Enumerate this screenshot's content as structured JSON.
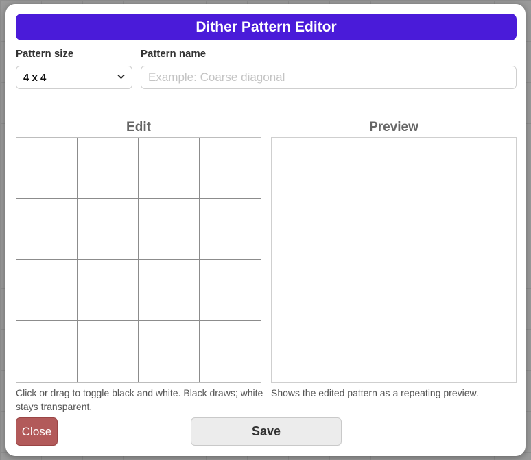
{
  "dialog": {
    "title": "Dither Pattern Editor"
  },
  "pattern_size": {
    "label": "Pattern size",
    "selected": "4 x 4"
  },
  "pattern_name": {
    "label": "Pattern name",
    "value": "",
    "placeholder": "Example: Coarse diagonal"
  },
  "edit": {
    "title": "Edit",
    "grid_rows": 4,
    "grid_cols": 4,
    "hint": "Click or drag to toggle black and white. Black draws; white stays transparent."
  },
  "preview": {
    "title": "Preview",
    "hint": "Shows the edited pattern as a repeating preview."
  },
  "buttons": {
    "close_label": "Close",
    "save_label": "Save"
  },
  "colors": {
    "title_bar": "#4a1bd9",
    "close_button": "#b25a5a",
    "save_button": "#ececec"
  },
  "icons": {
    "select_arrow": "chevron-down-icon"
  }
}
